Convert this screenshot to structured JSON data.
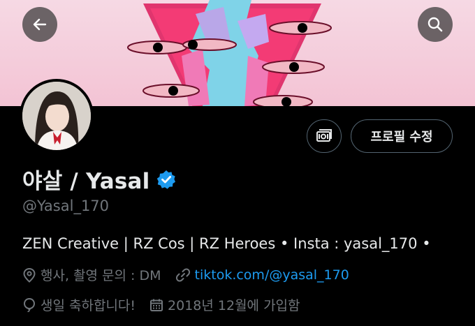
{
  "header": {
    "back_icon": "arrow-left-icon",
    "search_icon": "search-icon"
  },
  "profile": {
    "display_name": "야살 / Yasal",
    "verified": true,
    "verified_color": "#1d9bf0",
    "handle": "@Yasal_170",
    "bio": "ZEN Creative | RZ Cos | RZ Heroes • Insta : yasal_170 •",
    "location": "행사, 촬영 문의 : DM",
    "website": "tiktok.com/@yasal_170",
    "birthday": "생일 축하합니다!",
    "joined": "2018년 12월에 가입함"
  },
  "actions": {
    "edit_profile_label": "프로필 수정",
    "professional_icon": "money-icon"
  },
  "colors": {
    "background": "#000000",
    "muted_text": "#71767b",
    "link": "#1d9bf0",
    "button_border": "#536471"
  }
}
